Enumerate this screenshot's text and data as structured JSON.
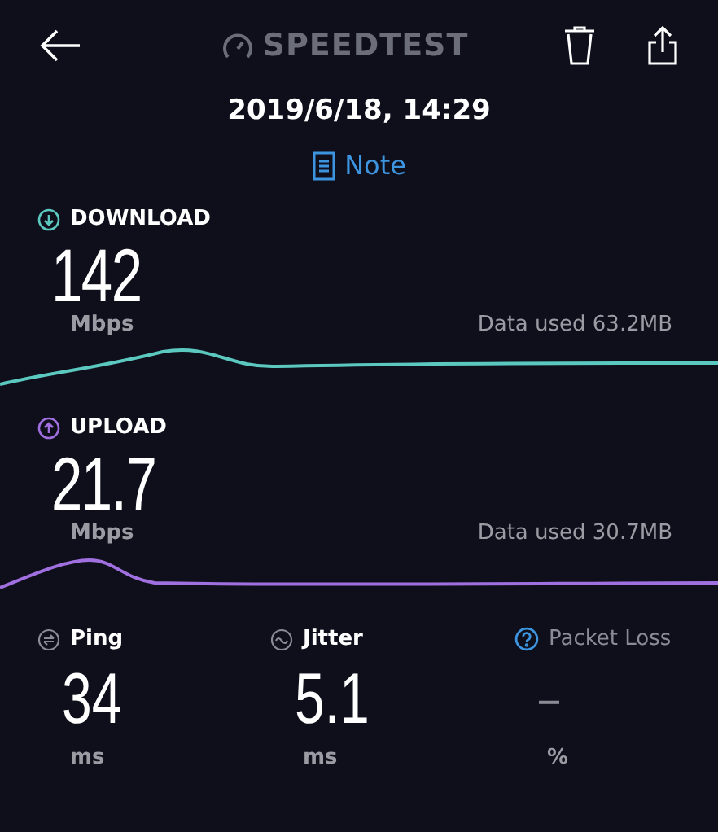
{
  "header": {
    "title": "SPEEDTEST"
  },
  "date": "2019/6/18, 14:29",
  "note_link": "Note",
  "speeds": [
    {
      "kind": "download",
      "label": "DOWNLOAD",
      "value": "142",
      "unit": "Mbps",
      "data_used": "Data used 63.2MB",
      "color": "#5cc9c0"
    },
    {
      "kind": "upload",
      "label": "UPLOAD",
      "value": "21.7",
      "unit": "Mbps",
      "data_used": "Data used 30.7MB",
      "color": "#a070e0"
    }
  ],
  "stats": [
    {
      "kind": "ping",
      "label": "Ping",
      "value": "34",
      "unit": "ms",
      "disabled": false
    },
    {
      "kind": "jitter",
      "label": "Jitter",
      "value": "5.1",
      "unit": "ms",
      "disabled": false
    },
    {
      "kind": "packet_loss",
      "label": "Packet Loss",
      "value": "–",
      "unit": "%",
      "disabled": true
    }
  ]
}
